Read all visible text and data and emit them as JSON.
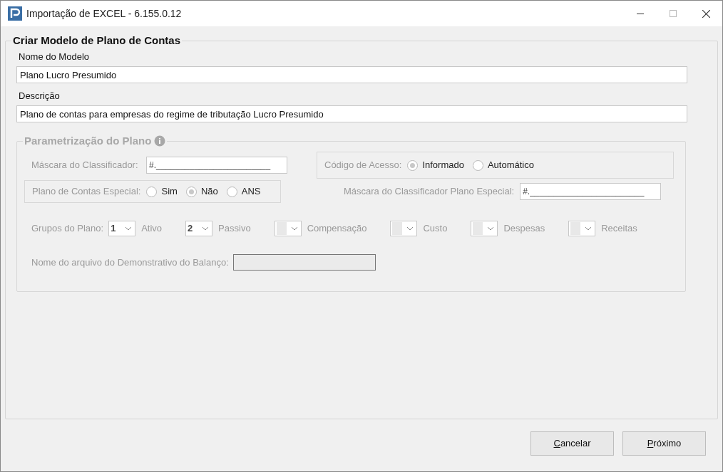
{
  "window": {
    "title": "Importação de EXCEL - 6.155.0.12"
  },
  "group": {
    "title": "Criar Modelo de Plano de Contas",
    "fields": [
      {
        "label": "Nome do Modelo",
        "value": "Plano Lucro Presumido"
      },
      {
        "label": "Descrição",
        "value": "Plano de contas para empresas do regime de tributação Lucro Presumido"
      }
    ]
  },
  "parametrizacao": {
    "title": "Parametrização do Plano",
    "disabled": true,
    "mascara": {
      "label": "Máscara do Classificador:",
      "value": "#.________________________"
    },
    "codigo_acesso": {
      "label": "Código de Acesso:",
      "options": [
        {
          "label": "Informado",
          "selected": true
        },
        {
          "label": "Automático",
          "selected": false
        }
      ]
    },
    "plano_especial": {
      "label": "Plano de Contas Especial:",
      "options": [
        {
          "label": "Sim",
          "selected": false
        },
        {
          "label": "Não",
          "selected": true
        },
        {
          "label": "ANS",
          "selected": false
        }
      ]
    },
    "mascara_especial": {
      "label": "Máscara do Classificador Plano Especial:",
      "value": "#.________________________"
    },
    "grupos": {
      "label": "Grupos do Plano:",
      "items": [
        {
          "value": "1",
          "label": "Ativo"
        },
        {
          "value": "2",
          "label": "Passivo"
        },
        {
          "value": "",
          "label": "Compensação"
        },
        {
          "value": "",
          "label": "Custo"
        },
        {
          "value": "",
          "label": "Despesas"
        },
        {
          "value": "",
          "label": "Receitas"
        }
      ]
    },
    "arquivo": {
      "label": "Nome do arquivo do Demonstrativo do Balanço:"
    }
  },
  "buttons": [
    "Cancelar",
    "Próximo"
  ]
}
